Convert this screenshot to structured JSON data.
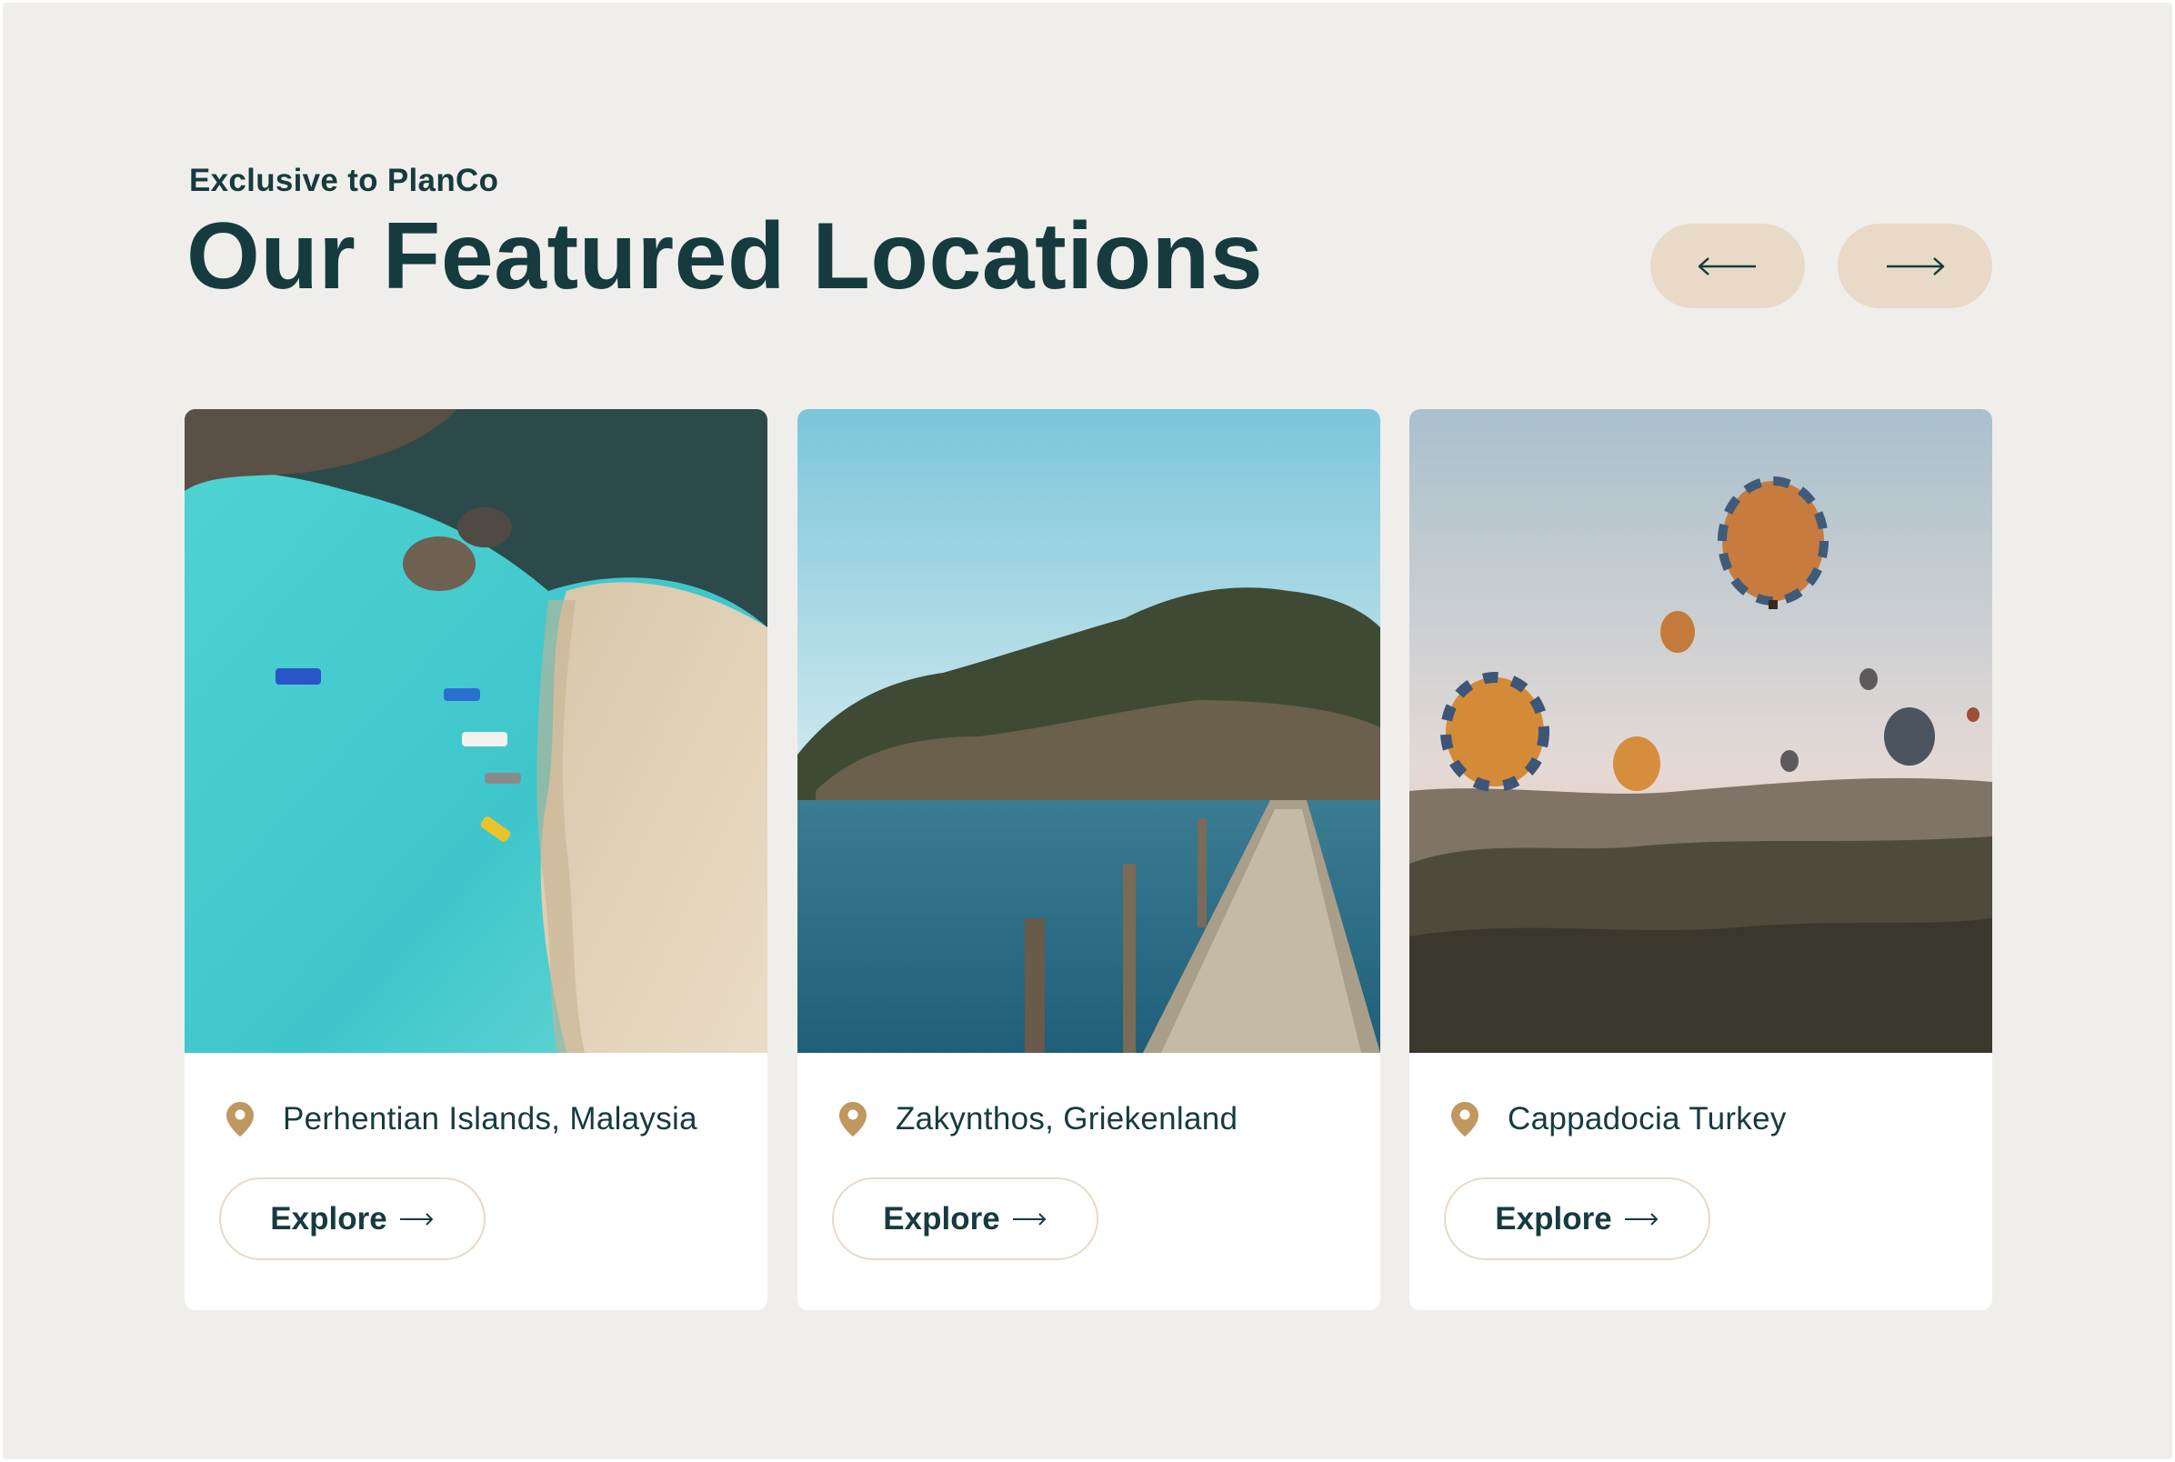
{
  "header": {
    "eyebrow": "Exclusive to PlanCo",
    "title": "Our Featured Locations"
  },
  "nav": {
    "prev_icon": "arrow-left-icon",
    "next_icon": "arrow-right-icon"
  },
  "cards": [
    {
      "location": "Perhentian Islands, Malaysia",
      "button_label": "Explore",
      "button_icon": "arrow-right-icon",
      "pin_icon": "map-pin-icon"
    },
    {
      "location": "Zakynthos, Griekenland",
      "button_label": "Explore",
      "button_icon": "arrow-right-icon",
      "pin_icon": "map-pin-icon"
    },
    {
      "location": "Cappadocia Turkey",
      "button_label": "Explore",
      "button_icon": "arrow-right-icon",
      "pin_icon": "map-pin-icon"
    }
  ],
  "colors": {
    "background": "#f0eeeb",
    "heading": "#163b3e",
    "accent": "#e8dac6",
    "pin": "#bf975f",
    "button_border": "#e7d9c7"
  }
}
